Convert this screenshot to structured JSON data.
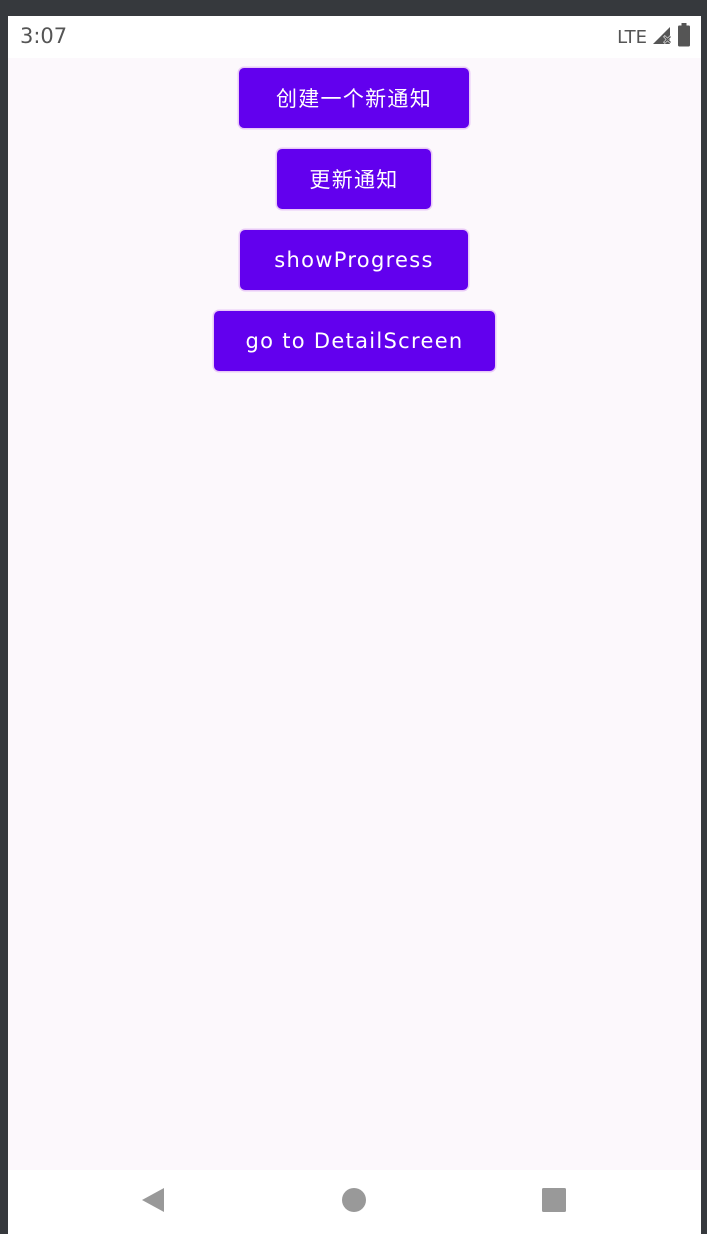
{
  "status_bar": {
    "time": "3:07",
    "network": "LTE",
    "icons": [
      "signal-no-service-icon",
      "battery-icon"
    ]
  },
  "buttons": {
    "create_notification": "创建一个新通知",
    "update_notification": "更新通知",
    "show_progress": "showProgress",
    "go_to_detail": "go to DetailScreen"
  },
  "nav_bar": {
    "icons": [
      "back-icon",
      "home-icon",
      "recents-icon"
    ]
  },
  "colors": {
    "button_bg": "#6200ee",
    "button_text": "#ffffff",
    "screen_bg": "#fcf8fc",
    "device_frame": "#36393d",
    "status_text": "#555555",
    "nav_icon": "#999999"
  }
}
